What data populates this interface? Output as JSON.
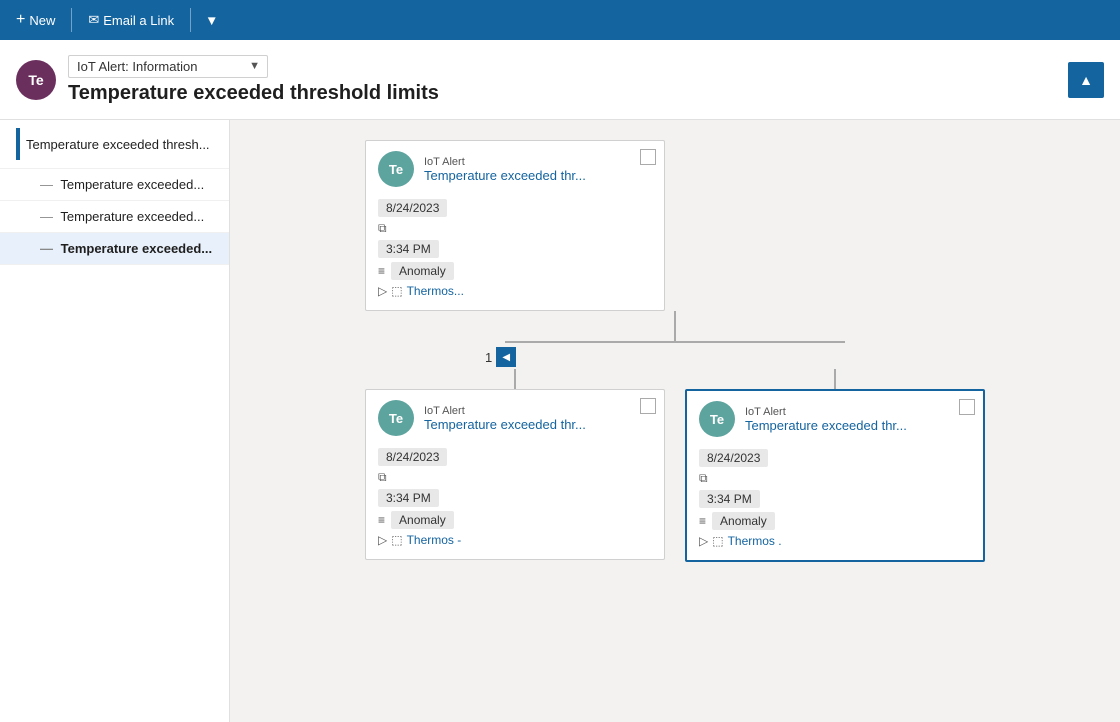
{
  "toolbar": {
    "new_label": "New",
    "email_label": "Email a Link"
  },
  "header": {
    "avatar_initials": "Te",
    "select_value": "IoT Alert: Information",
    "title": "Temperature exceeded threshold limits",
    "collapse_icon": "▲"
  },
  "sidebar": {
    "items": [
      {
        "id": "item-1",
        "label": "Temperature exceeded thresh...",
        "level": "header",
        "active": false
      },
      {
        "id": "item-2",
        "label": "Temperature exceeded...",
        "level": "child",
        "active": false
      },
      {
        "id": "item-3",
        "label": "Temperature exceeded...",
        "level": "child",
        "active": false
      },
      {
        "id": "item-4",
        "label": "Temperature exceeded...",
        "level": "child",
        "active": true
      }
    ]
  },
  "cards": {
    "root": {
      "avatar": "Te",
      "type": "IoT Alert",
      "name": "Temperature exceeded thr...",
      "date": "8/24/2023",
      "time": "3:34 PM",
      "tag": "Anomaly",
      "link": "Thermos..."
    },
    "child1": {
      "avatar": "Te",
      "type": "IoT Alert",
      "name": "Temperature exceeded thr...",
      "date": "8/24/2023",
      "time": "3:34 PM",
      "tag": "Anomaly",
      "link": "Thermos -"
    },
    "child2": {
      "avatar": "Te",
      "type": "IoT Alert",
      "name": "Temperature exceeded thr...",
      "date": "8/24/2023",
      "time": "3:34 PM",
      "tag": "Anomaly",
      "link": "Thermos ."
    }
  },
  "pagination": {
    "current": "1"
  }
}
